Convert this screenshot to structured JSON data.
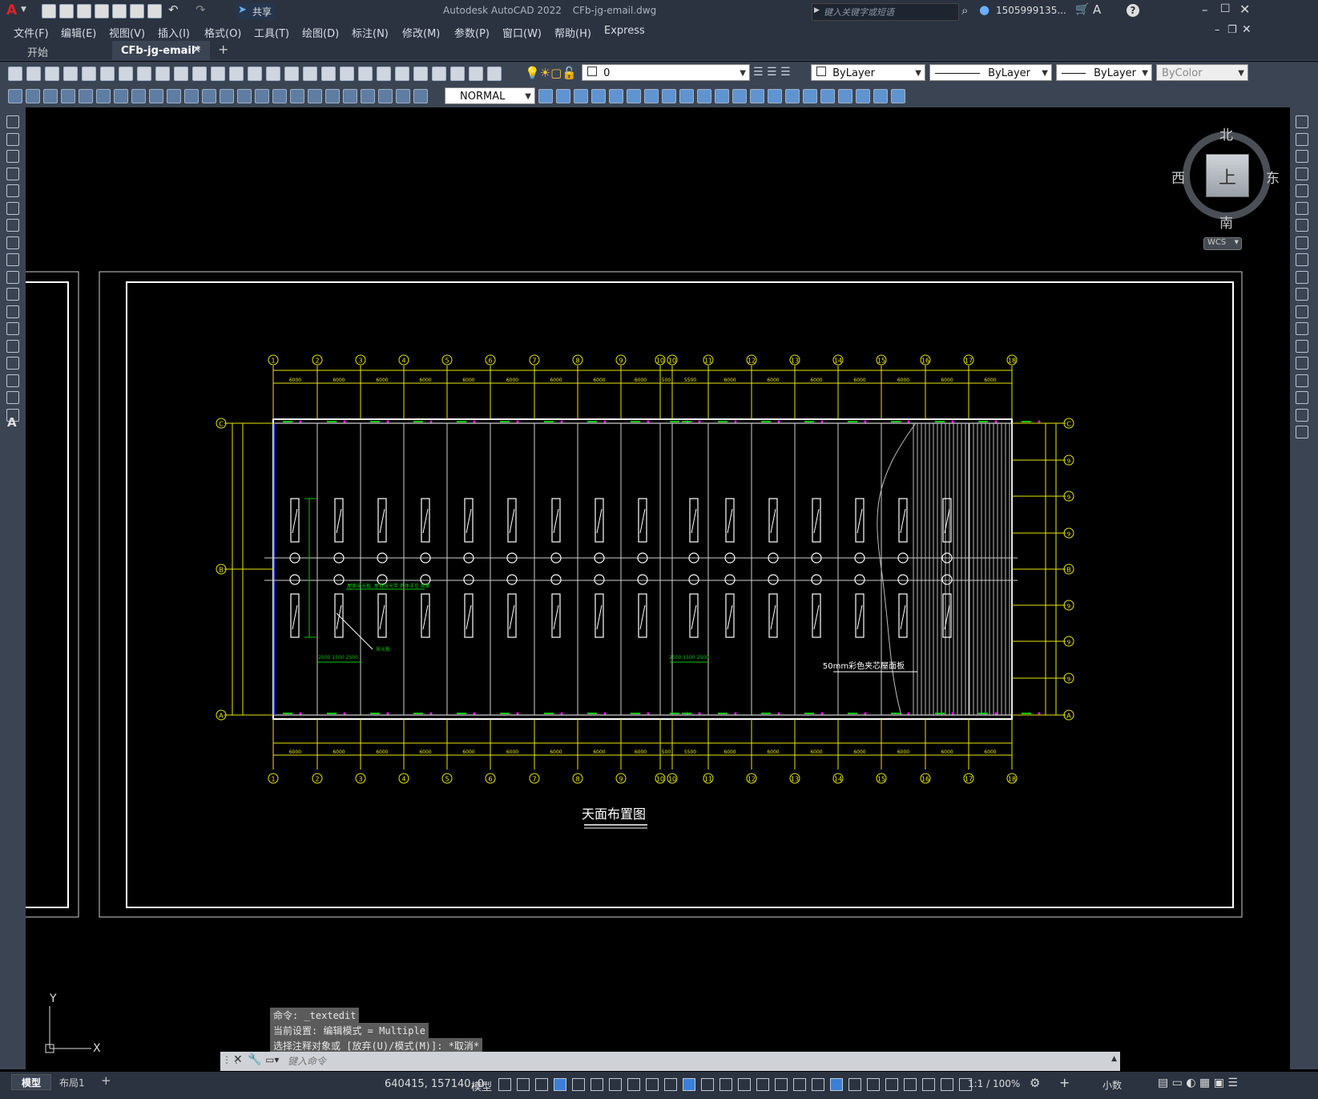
{
  "titlebar": {
    "app_logo": "A",
    "share_label": "共享",
    "title": "Autodesk AutoCAD 2022",
    "filename": "CFb-jg-email.dwg",
    "search_placeholder": "键入关键字或短语",
    "user": "1505999135...",
    "help": "?"
  },
  "menu": [
    "文件(F)",
    "编辑(E)",
    "视图(V)",
    "插入(I)",
    "格式(O)",
    "工具(T)",
    "绘图(D)",
    "标注(N)",
    "修改(M)",
    "参数(P)",
    "窗口(W)",
    "帮助(H)",
    "Express"
  ],
  "tabs": {
    "start": "开始",
    "active": "CFb-jg-email*",
    "add": "+"
  },
  "toolbar": {
    "layer_value": "0",
    "color": "ByLayer",
    "linetype": "ByLayer",
    "lineweight": "ByLayer",
    "plotstyle": "ByColor",
    "dimstyle": "NORMAL"
  },
  "viewcube": {
    "north": "北",
    "south": "南",
    "east": "东",
    "west": "西",
    "face": "上",
    "wcs": "WCS"
  },
  "drawing": {
    "title": "天面布置图",
    "note": "50mm彩色夹芯屋面板",
    "grid_top": [
      "1",
      "2",
      "3",
      "4",
      "5",
      "6",
      "7",
      "8",
      "9",
      "10",
      "10",
      "11",
      "12",
      "13",
      "14",
      "15",
      "16",
      "17",
      "18"
    ],
    "grid_side": [
      "C",
      "B",
      "A"
    ],
    "grid_right_extra": [
      "9",
      "9",
      "9",
      "9",
      "9",
      "9"
    ],
    "dim_top": [
      "6000",
      "6000",
      "6000",
      "6000",
      "6000",
      "6000",
      "6000",
      "6000",
      "6000",
      "500",
      "5500",
      "6000",
      "6000",
      "6000",
      "6000",
      "6000",
      "6000",
      "6000"
    ],
    "small_label_1": "2500 1500 2500",
    "small_label_2": "2500 1500 2500",
    "leader_text": "采光板",
    "green_note": "屋面采光板, 屋脊采光带 具体详见 图集"
  },
  "ucs": {
    "x": "X",
    "y": "Y"
  },
  "command": {
    "line1": "命令: _textedit",
    "line2": "当前设置: 编辑模式 = Multiple",
    "line3": "选择注释对象或 [放弃(U)/模式(M)]: *取消*",
    "input_placeholder": "键入命令"
  },
  "status": {
    "model_tab": "模型",
    "layout_tab": "布局1",
    "add": "+",
    "coords": "640415, 157140, 0",
    "space": "模型",
    "scale": "1:1 / 100%",
    "units": "小数"
  },
  "colors": {
    "yellow": "#e6e600",
    "green": "#00c800",
    "white": "#ffffff",
    "magenta": "#ff00ff"
  }
}
